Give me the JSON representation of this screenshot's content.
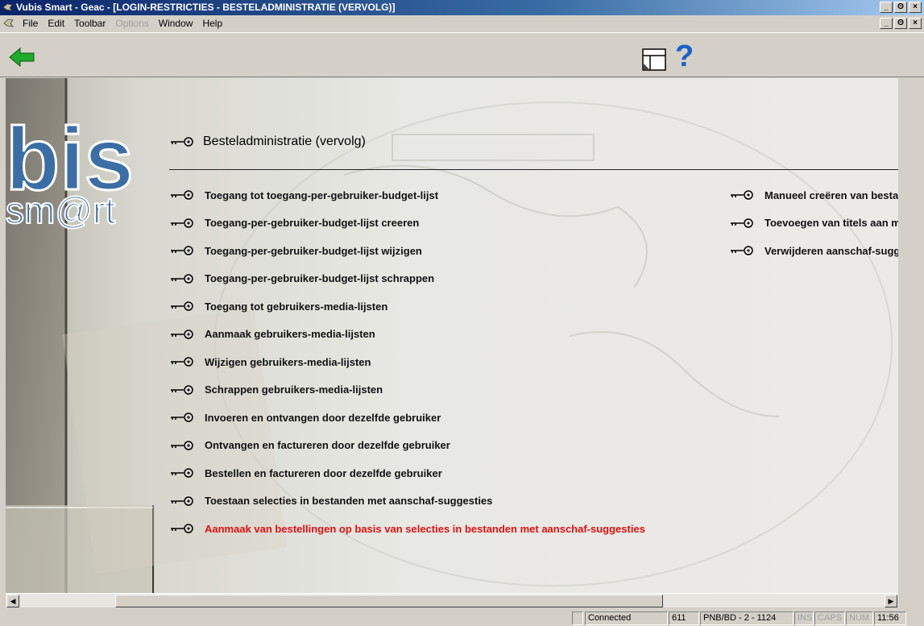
{
  "window": {
    "title": "Vubis Smart - Geac - [LOGIN-RESTRICTIES - BESTELADMINISTRATIE (VERVOLG)]",
    "buttons": [
      "_",
      "ʘ",
      "×"
    ]
  },
  "menubar": {
    "items": [
      {
        "label": "File",
        "enabled": true
      },
      {
        "label": "Edit",
        "enabled": true
      },
      {
        "label": "Toolbar",
        "enabled": true
      },
      {
        "label": "Options",
        "enabled": false
      },
      {
        "label": "Window",
        "enabled": true
      },
      {
        "label": "Help",
        "enabled": true
      }
    ]
  },
  "toolbar": {
    "help_glyph": "?",
    "icons": [
      "back-arrow-icon",
      "window-icon",
      "help-icon"
    ]
  },
  "logo": {
    "text": "bis smart"
  },
  "heading": "Besteladministratie (vervolg)",
  "options_left": [
    {
      "label": "Toegang tot toegang-per-gebruiker-budget-lijst"
    },
    {
      "label": "Toegang-per-gebruiker-budget-lijst creeren"
    },
    {
      "label": "Toegang-per-gebruiker-budget-lijst wijzigen"
    },
    {
      "label": "Toegang-per-gebruiker-budget-lijst schrappen"
    },
    {
      "label": "Toegang tot gebruikers-media-lijsten"
    },
    {
      "label": "Aanmaak gebruikers-media-lijsten"
    },
    {
      "label": "Wijzigen gebruikers-media-lijsten"
    },
    {
      "label": "Schrappen gebruikers-media-lijsten"
    },
    {
      "label": "Invoeren en ontvangen door dezelfde gebruiker"
    },
    {
      "label": "Ontvangen en factureren door dezelfde gebruiker"
    },
    {
      "label": "Bestellen en factureren door dezelfde gebruiker"
    },
    {
      "label": "Toestaan selecties in bestanden met aanschaf-suggesties"
    },
    {
      "label": "Aanmaak van bestellingen op basis van selecties in bestanden met aanschaf-suggesties",
      "active": true
    }
  ],
  "options_right": [
    {
      "label": "Manueel creëren van bestar"
    },
    {
      "label": "Toevoegen van titels aan m"
    },
    {
      "label": "Verwijderen aanschaf-sugge"
    }
  ],
  "colors": {
    "active_option": "#e01010",
    "titlebar": "#0a246a"
  },
  "statusbar": {
    "connection": "Connected",
    "code": "611",
    "location": "PNB/BD - 2 - 1124",
    "ins": "INS",
    "caps": "CAPS",
    "num": "NUM",
    "time": "11:56"
  }
}
